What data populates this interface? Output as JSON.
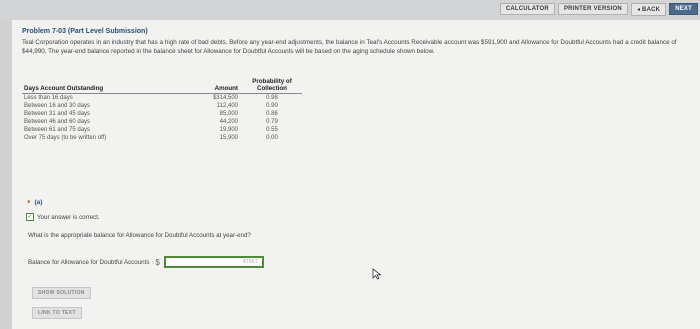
{
  "toolbar": {
    "calculator": "CALCULATOR",
    "printer_version": "PRINTER VERSION",
    "back": "◂ BACK",
    "next": "NEXT"
  },
  "problem": {
    "title": "Problem 7-03 (Part Level Submission)",
    "description": "Teal Corporation operates in an industry that has a high rate of bad debts. Before any year-end adjustments, the balance in Teal's Accounts Receivable account was $591,900 and Allowance for Doubtful Accounts had a credit balance of $44,990. The year-end balance reported in the balance sheet for Allowance for Doubtful Accounts will be based on the aging schedule shown below."
  },
  "table": {
    "headers": {
      "days": "Days Account Outstanding",
      "amount": "Amount",
      "probability": "Probability of Collection"
    },
    "rows": [
      {
        "days": "Less than 16 days",
        "amount": "$314,500",
        "prob": "0.98"
      },
      {
        "days": "Between 16 and 30 days",
        "amount": "112,400",
        "prob": "0.90"
      },
      {
        "days": "Between 31 and 45 days",
        "amount": "85,000",
        "prob": "0.86"
      },
      {
        "days": "Between 46 and 60 days",
        "amount": "44,200",
        "prob": "0.79"
      },
      {
        "days": "Between 61 and 75 days",
        "amount": "19,900",
        "prob": "0.55"
      },
      {
        "days": "Over 75 days (to be written off)",
        "amount": "15,900",
        "prob": "0.00"
      }
    ]
  },
  "part_a": {
    "label": "(a)",
    "feedback": "Your answer is correct.",
    "question": "What is the appropriate balance for Allowance for Doubtful Accounts at year-end?",
    "answer_label": "Balance for Allowance for Doubtful Accounts",
    "currency": "$",
    "answer_value": "47667",
    "show_solution": "SHOW SOLUTION",
    "link_to_text": "LINK TO TEXT"
  }
}
